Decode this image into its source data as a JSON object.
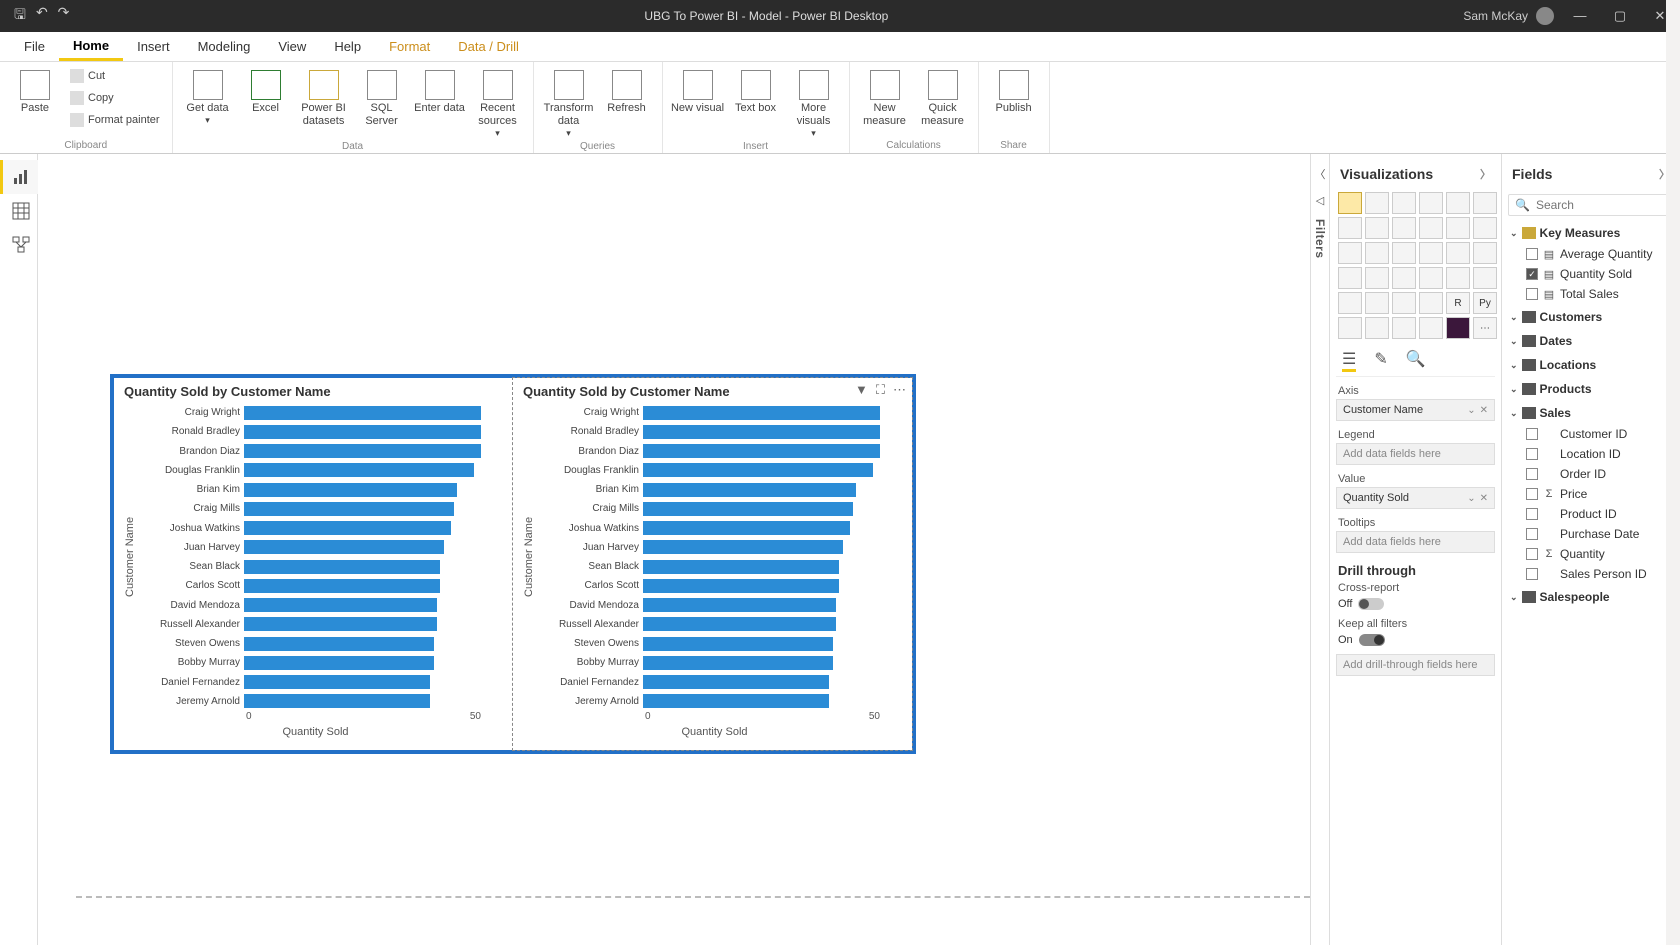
{
  "titlebar": {
    "title": "UBG To Power BI - Model - Power BI Desktop",
    "user": "Sam McKay"
  },
  "ribbon_tabs": [
    "File",
    "Home",
    "Insert",
    "Modeling",
    "View",
    "Help",
    "Format",
    "Data / Drill"
  ],
  "clipboard": {
    "paste": "Paste",
    "cut": "Cut",
    "copy": "Copy",
    "fp": "Format painter",
    "group": "Clipboard"
  },
  "data_group": {
    "get": "Get data",
    "excel": "Excel",
    "pbids": "Power BI datasets",
    "sql": "SQL Server",
    "enter": "Enter data",
    "recent": "Recent sources",
    "group": "Data"
  },
  "queries": {
    "transform": "Transform data",
    "refresh": "Refresh",
    "group": "Queries"
  },
  "insert": {
    "newv": "New visual",
    "text": "Text box",
    "more": "More visuals",
    "group": "Insert"
  },
  "calc": {
    "newm": "New measure",
    "quick": "Quick measure",
    "group": "Calculations"
  },
  "share": {
    "publish": "Publish",
    "group": "Share"
  },
  "panes": {
    "filters": "Filters",
    "viz": "Visualizations",
    "fields": "Fields"
  },
  "search_placeholder": "Search",
  "viz_section": {
    "axis": "Axis",
    "legend": "Legend",
    "value": "Value",
    "tooltips": "Tooltips",
    "axis_val": "Customer Name",
    "value_val": "Quantity Sold",
    "placeholder": "Add data fields here",
    "drill": "Drill through",
    "cross": "Cross-report",
    "keep": "Keep all filters",
    "off": "Off",
    "on": "On",
    "drill_ph": "Add drill-through fields here"
  },
  "fields": {
    "tables": [
      {
        "name": "Key Measures",
        "kind": "meas",
        "expanded": true,
        "fields": [
          {
            "name": "Average Quantity",
            "icon": "calc",
            "checked": false
          },
          {
            "name": "Quantity Sold",
            "icon": "calc",
            "checked": true
          },
          {
            "name": "Total Sales",
            "icon": "calc",
            "checked": false
          }
        ]
      },
      {
        "name": "Customers",
        "kind": "table",
        "expanded": false,
        "fields": []
      },
      {
        "name": "Dates",
        "kind": "table",
        "expanded": false,
        "fields": []
      },
      {
        "name": "Locations",
        "kind": "table",
        "expanded": false,
        "fields": []
      },
      {
        "name": "Products",
        "kind": "table",
        "expanded": false,
        "fields": []
      },
      {
        "name": "Sales",
        "kind": "table",
        "expanded": true,
        "fields": [
          {
            "name": "Customer ID",
            "icon": "",
            "checked": false
          },
          {
            "name": "Location ID",
            "icon": "",
            "checked": false
          },
          {
            "name": "Order ID",
            "icon": "",
            "checked": false
          },
          {
            "name": "Price",
            "icon": "sum",
            "checked": false
          },
          {
            "name": "Product ID",
            "icon": "",
            "checked": false
          },
          {
            "name": "Purchase Date",
            "icon": "",
            "checked": false
          },
          {
            "name": "Quantity",
            "icon": "sum",
            "checked": false
          },
          {
            "name": "Sales Person ID",
            "icon": "",
            "checked": false
          }
        ]
      },
      {
        "name": "Salespeople",
        "kind": "table",
        "expanded": false,
        "fields": []
      }
    ]
  },
  "chart_data": [
    {
      "type": "bar",
      "orientation": "horizontal",
      "title": "Quantity Sold by Customer Name",
      "xlabel": "Quantity Sold",
      "ylabel": "Customer Name",
      "xticks": [
        0,
        50
      ],
      "xlim": [
        0,
        70
      ],
      "categories": [
        "Craig Wright",
        "Ronald Bradley",
        "Brandon Diaz",
        "Douglas Franklin",
        "Brian Kim",
        "Craig Mills",
        "Joshua Watkins",
        "Juan Harvey",
        "Sean Black",
        "Carlos Scott",
        "David Mendoza",
        "Russell Alexander",
        "Steven Owens",
        "Bobby Murray",
        "Daniel Fernandez",
        "Jeremy Arnold"
      ],
      "values": [
        70,
        70,
        70,
        68,
        63,
        62,
        61,
        59,
        58,
        58,
        57,
        57,
        56,
        56,
        55,
        55
      ]
    },
    {
      "type": "bar",
      "orientation": "horizontal",
      "title": "Quantity Sold by Customer Name",
      "xlabel": "Quantity Sold",
      "ylabel": "Customer Name",
      "xticks": [
        0,
        50
      ],
      "xlim": [
        0,
        70
      ],
      "categories": [
        "Craig Wright",
        "Ronald Bradley",
        "Brandon Diaz",
        "Douglas Franklin",
        "Brian Kim",
        "Craig Mills",
        "Joshua Watkins",
        "Juan Harvey",
        "Sean Black",
        "Carlos Scott",
        "David Mendoza",
        "Russell Alexander",
        "Steven Owens",
        "Bobby Murray",
        "Daniel Fernandez",
        "Jeremy Arnold"
      ],
      "values": [
        70,
        70,
        70,
        68,
        63,
        62,
        61,
        59,
        58,
        58,
        57,
        57,
        56,
        56,
        55,
        55
      ]
    }
  ]
}
